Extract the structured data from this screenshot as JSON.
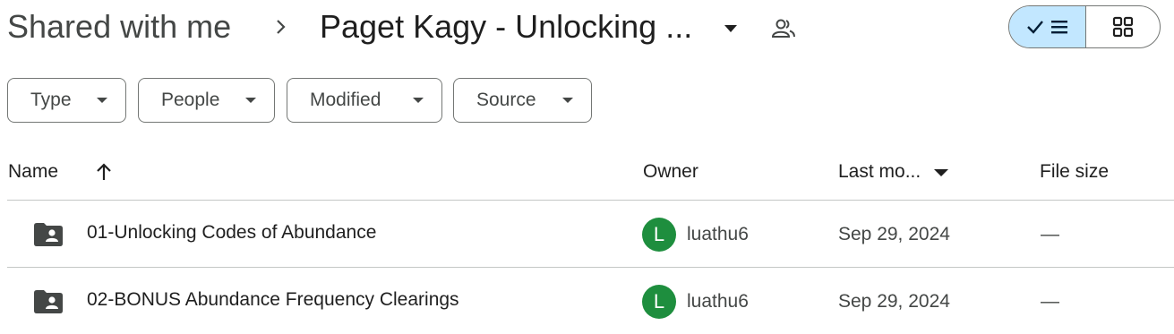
{
  "breadcrumb": {
    "root": "Shared with me",
    "current": "Paget Kagy - Unlocking ...",
    "separator_icon": "chevron-right-icon",
    "dropdown_icon": "caret-down-icon",
    "shared_icon": "people-icon"
  },
  "view_toggle": {
    "active": "list",
    "list_icon": "check-list-icon",
    "grid_icon": "grid-icon"
  },
  "filters": [
    "Type",
    "People",
    "Modified",
    "Source"
  ],
  "columns": {
    "name": "Name",
    "owner": "Owner",
    "last_modified": "Last mo...",
    "file_size": "File size"
  },
  "rows": [
    {
      "name": "01-Unlocking Codes of Abundance",
      "owner_initial": "L",
      "owner": "luathu6",
      "date": "Sep 29, 2024",
      "size": "—"
    },
    {
      "name": "02-BONUS Abundance Frequency Clearings",
      "owner_initial": "L",
      "owner": "luathu6",
      "date": "Sep 29, 2024",
      "size": "—"
    }
  ],
  "colors": {
    "accent": "#c2e7ff",
    "avatar": "#1e8e3e",
    "border": "#747775",
    "divider": "#c4c7c5"
  }
}
